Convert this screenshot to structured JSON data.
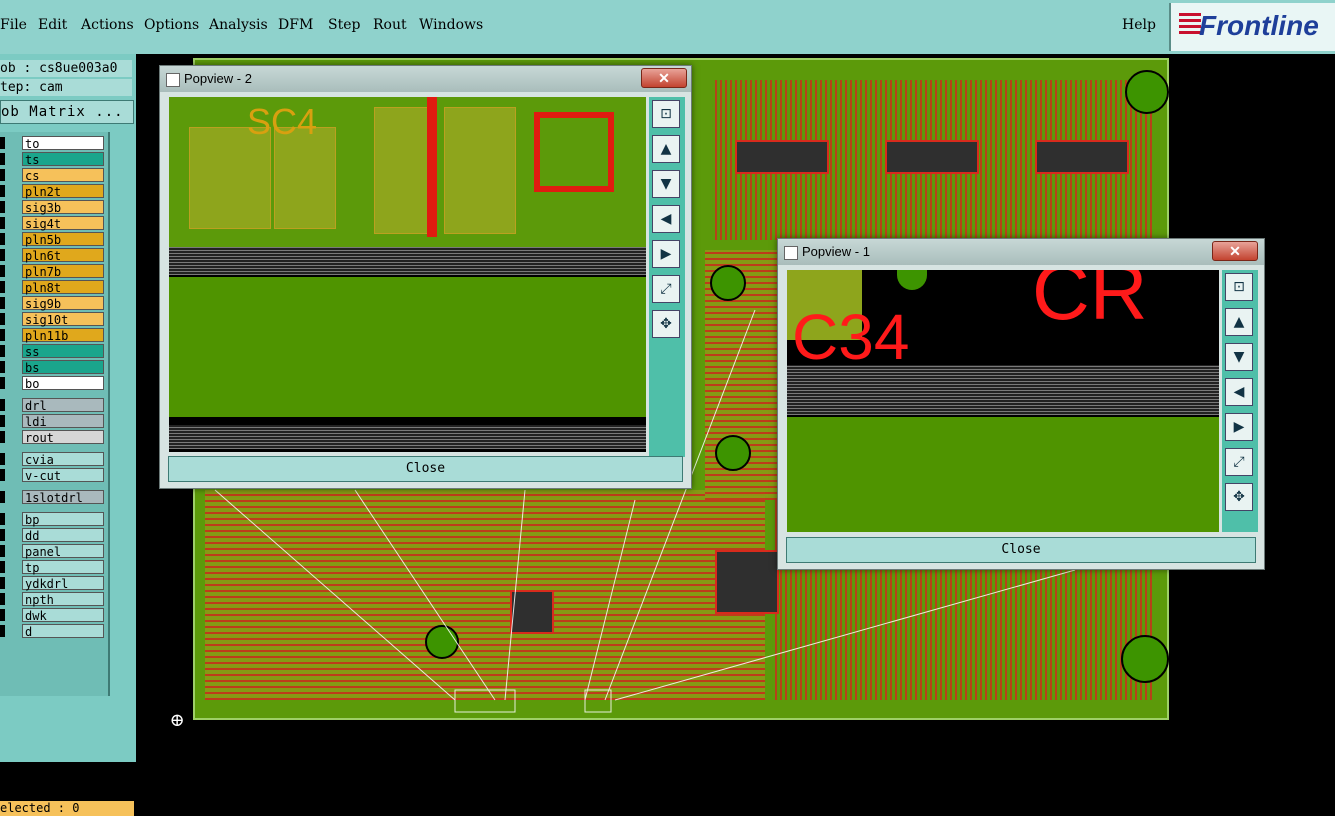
{
  "menubar": {
    "items": [
      "File",
      "Edit",
      "Actions",
      "Options",
      "Analysis",
      "DFM",
      "Step",
      "Rout",
      "Windows"
    ],
    "help": "Help"
  },
  "logo": {
    "text": "Frontline"
  },
  "job": {
    "job_line": "ob : cs8ue003a0",
    "step_line": "tep: cam",
    "matrix_button": "ob Matrix ..."
  },
  "layers": [
    {
      "name": "to",
      "color": "#ffffff"
    },
    {
      "name": "ts",
      "color": "#1aa58c"
    },
    {
      "name": "cs",
      "color": "#f6c15a"
    },
    {
      "name": "pln2t",
      "color": "#e0a81c"
    },
    {
      "name": "sig3b",
      "color": "#f6c15a"
    },
    {
      "name": "sig4t",
      "color": "#f6c15a"
    },
    {
      "name": "pln5b",
      "color": "#e0a81c"
    },
    {
      "name": "pln6t",
      "color": "#e0a81c"
    },
    {
      "name": "pln7b",
      "color": "#e0a81c"
    },
    {
      "name": "pln8t",
      "color": "#e0a81c"
    },
    {
      "name": "sig9b",
      "color": "#f6c15a"
    },
    {
      "name": "sig10t",
      "color": "#f6c15a"
    },
    {
      "name": "pln11b",
      "color": "#e0a81c"
    },
    {
      "name": "ss",
      "color": "#1aa58c"
    },
    {
      "name": "bs",
      "color": "#1aa58c"
    },
    {
      "name": "bo",
      "color": "#ffffff"
    },
    {
      "name": "drl",
      "color": "#a9b9bd"
    },
    {
      "name": "ldi",
      "color": "#a9b9bd"
    },
    {
      "name": "rout",
      "color": "#d6d6d6"
    },
    {
      "name": "cvia",
      "color": "#a9dcd7"
    },
    {
      "name": "v-cut",
      "color": "#a9dcd7"
    },
    {
      "name": "1slotdrl",
      "color": "#a9b9bd"
    },
    {
      "name": "bp",
      "color": "#a9dcd7"
    },
    {
      "name": "dd",
      "color": "#a9dcd7"
    },
    {
      "name": "panel",
      "color": "#a9dcd7"
    },
    {
      "name": "tp",
      "color": "#a9dcd7"
    },
    {
      "name": "ydkdrl",
      "color": "#a9dcd7"
    },
    {
      "name": "npth",
      "color": "#a9dcd7"
    },
    {
      "name": "dwk",
      "color": "#a9dcd7"
    },
    {
      "name": "d",
      "color": "#a9dcd7"
    }
  ],
  "status": {
    "selected": "elected : 0"
  },
  "popview2": {
    "title": "Popview - 2",
    "close_x": "✕",
    "close_label": "Close",
    "silkscreen": "SC4"
  },
  "popview1": {
    "title": "Popview - 1",
    "close_x": "✕",
    "close_label": "Close",
    "silkscreen_a": "C34",
    "silkscreen_b": "CR"
  },
  "colors": {
    "menubar": "#8fd2cc",
    "board": "#5c9a0a",
    "copper": "#c9321c",
    "silk": "#ff1a1a"
  },
  "toolbar_icons": [
    "zoom-window-icon",
    "pan-up-icon",
    "pan-down-icon",
    "pan-left-icon",
    "pan-right-icon",
    "zoom-fit-icon",
    "zoom-home-icon"
  ]
}
